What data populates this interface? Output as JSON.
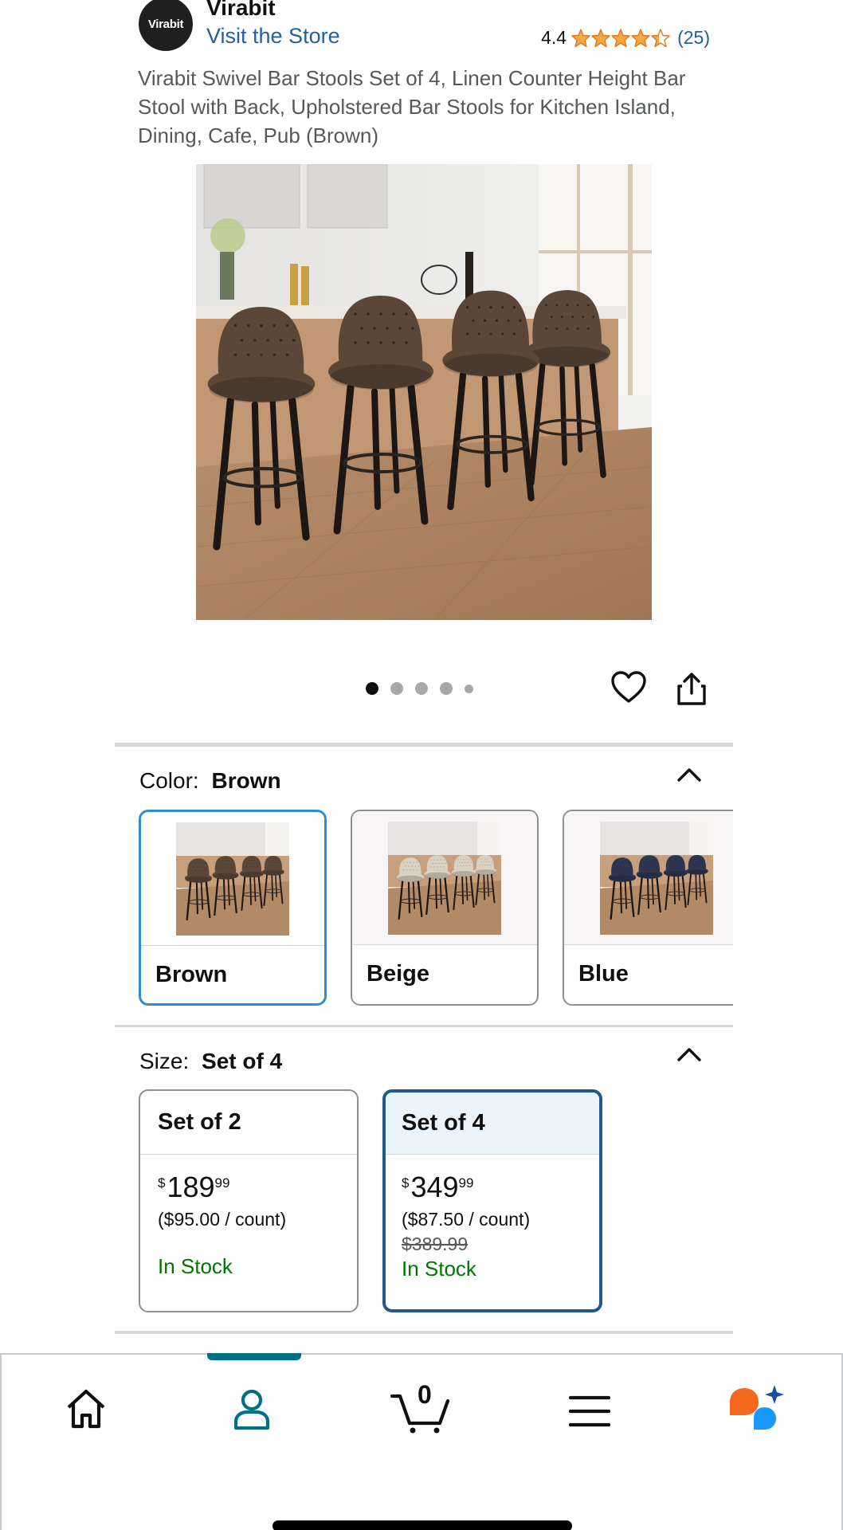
{
  "header": {
    "brand_logo_text": "Virabit",
    "brand_name": "Virabit",
    "store_link": "Visit the Store",
    "rating_value": "4.4",
    "rating_stars": 4.4,
    "rating_count": "(25)",
    "star_color": "#f3a847"
  },
  "product": {
    "title": "Virabit Swivel Bar Stools Set of 4, Linen Counter Height Bar Stool with Back, Upholstered Bar Stools for Kitchen Island, Dining, Cafe, Pub (Brown)",
    "image_count": 5,
    "active_image": 1
  },
  "color_section": {
    "key": "Color:",
    "value": "Brown",
    "options": [
      {
        "label": "Brown",
        "selected": true,
        "fabric": "#5a4738"
      },
      {
        "label": "Beige",
        "selected": false,
        "fabric": "#d9d2c3"
      },
      {
        "label": "Blue",
        "selected": false,
        "fabric": "#2e3552"
      }
    ]
  },
  "size_section": {
    "key": "Size:",
    "value": "Set of 4",
    "options": [
      {
        "label": "Set of 2",
        "price_currency": "$",
        "price_whole": "189",
        "price_fraction": "99",
        "unit_price": "($95.00 / count)",
        "list_price": "",
        "stock": "In Stock",
        "selected": false
      },
      {
        "label": "Set of 4",
        "price_currency": "$",
        "price_whole": "349",
        "price_fraction": "99",
        "unit_price": "($87.50 / count)",
        "list_price": "$389.99",
        "stock": "In Stock",
        "selected": true
      }
    ]
  },
  "bottom_nav": {
    "active": "account",
    "cart_count": "0",
    "items": [
      "home-icon",
      "account-icon",
      "cart-icon",
      "menu-icon",
      "rufus-assistant-icon"
    ]
  },
  "colors": {
    "link": "#2162a1",
    "in_stock": "#007600",
    "selected_color_border": "#2f8ccf",
    "selected_size_border": "#22588f",
    "nav_accent": "#007185"
  }
}
